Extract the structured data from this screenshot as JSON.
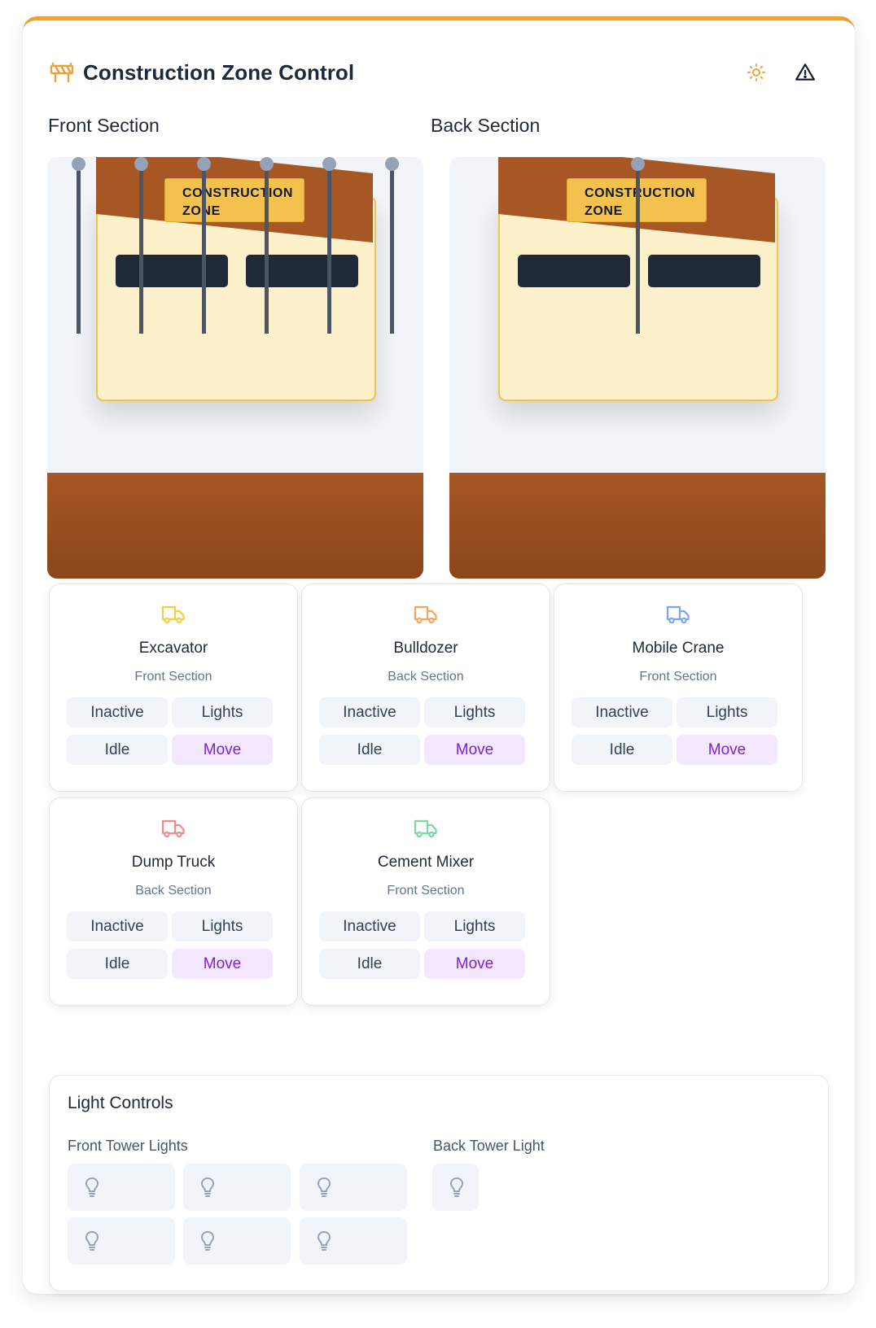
{
  "header": {
    "title": "Construction Zone Control",
    "logo_icon": "roadblock-icon",
    "actions": [
      {
        "name": "sun-icon",
        "color": "#e8a33d"
      },
      {
        "name": "warning-icon",
        "color": "#111827"
      }
    ]
  },
  "sections": {
    "front": {
      "label": "Front Section",
      "sign_line1": "CONSTRUCTION",
      "sign_line2": "ZONE"
    },
    "back": {
      "label": "Back Section",
      "sign_line1": "CONSTRUCTION",
      "sign_line2": "ZONE"
    }
  },
  "buttons": {
    "inactive": "Inactive",
    "lights": "Lights",
    "idle": "Idle",
    "move": "Move"
  },
  "vehicles": [
    {
      "name": "Excavator",
      "location": "Front Section",
      "icon": "truck-icon",
      "color": "#f4cf3f"
    },
    {
      "name": "Bulldozer",
      "location": "Back Section",
      "icon": "truck-icon",
      "color": "#f5a562"
    },
    {
      "name": "Mobile Crane",
      "location": "Front Section",
      "icon": "truck-icon",
      "color": "#7aa7f5"
    },
    {
      "name": "Dump Truck",
      "location": "Back Section",
      "icon": "truck-icon",
      "color": "#ef8d8d"
    },
    {
      "name": "Cement Mixer",
      "location": "Front Section",
      "icon": "truck-icon",
      "color": "#7fd6a0"
    }
  ],
  "light_controls": {
    "title": "Light Controls",
    "front_label": "Front Tower Lights",
    "back_label": "Back Tower Light",
    "icon": "lightbulb-icon"
  },
  "colors": {
    "accent": "#e8a33d",
    "ground": "#a65723",
    "roof": "#a65723",
    "sign": "#f2c14e",
    "move_text": "#7e22ce",
    "move_bg": "#f3e8ff"
  }
}
